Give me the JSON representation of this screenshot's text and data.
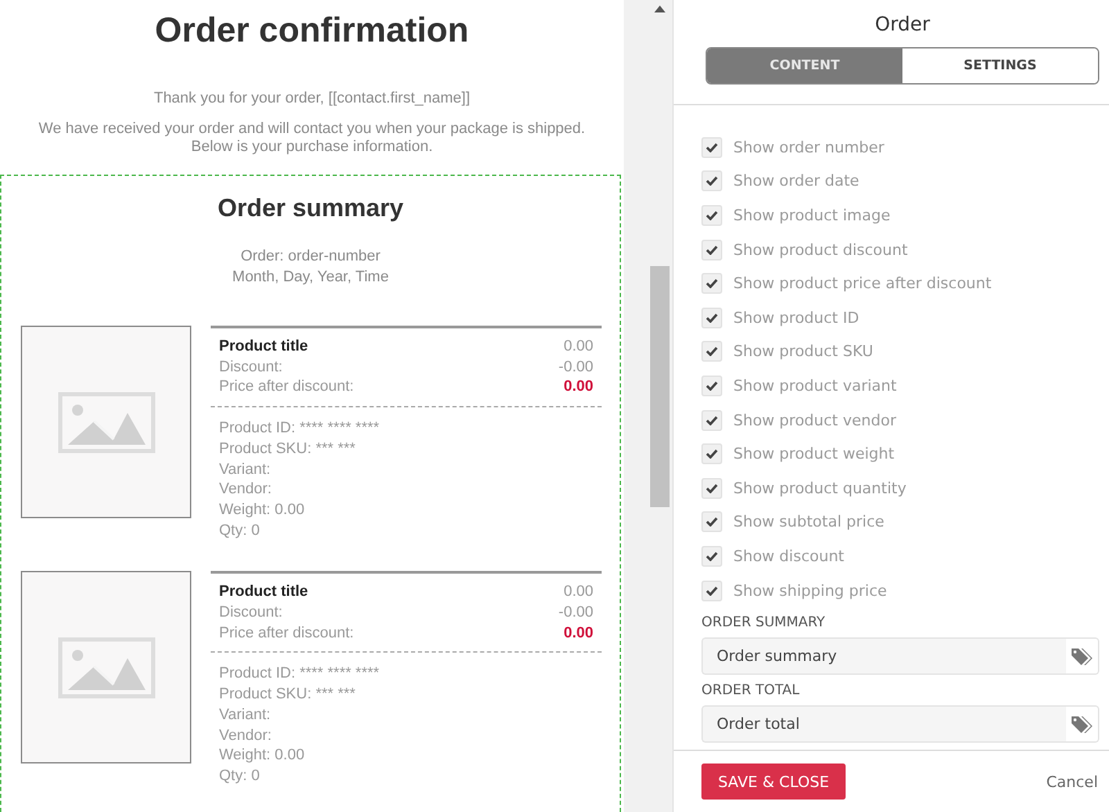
{
  "preview": {
    "title": "Order confirmation",
    "greeting": "Thank you for your order, [[contact.first_name]]",
    "intro": "We have received your order and will contact you when your package is shipped. Below is your purchase information.",
    "summary": {
      "title": "Order summary",
      "order_line": "Order: order-number",
      "date_line": "Month, Day, Year, Time",
      "products": [
        {
          "title": "Product title",
          "price": "0.00",
          "discount_label": "Discount:",
          "discount": "-0.00",
          "after_label": "Price after discount:",
          "after_price": "0.00",
          "details": [
            "Product ID: **** **** ****",
            "Product SKU: *** ***",
            "Variant:",
            "Vendor:",
            "Weight: 0.00",
            "Qty: 0"
          ]
        },
        {
          "title": "Product title",
          "price": "0.00",
          "discount_label": "Discount:",
          "discount": "-0.00",
          "after_label": "Price after discount:",
          "after_price": "0.00",
          "details": [
            "Product ID: **** **** ****",
            "Product SKU: *** ***",
            "Variant:",
            "Vendor:",
            "Weight: 0.00",
            "Qty: 0"
          ]
        }
      ]
    }
  },
  "panel": {
    "title": "Order",
    "tabs": [
      {
        "label": "CONTENT",
        "selected": true
      },
      {
        "label": "SETTINGS",
        "selected": false
      }
    ],
    "options": [
      {
        "label": "Show order number",
        "checked": true
      },
      {
        "label": "Show order date",
        "checked": true
      },
      {
        "label": "Show product image",
        "checked": true
      },
      {
        "label": "Show product discount",
        "checked": true
      },
      {
        "label": "Show product price after discount",
        "checked": true
      },
      {
        "label": "Show product ID",
        "checked": true
      },
      {
        "label": "Show product SKU",
        "checked": true
      },
      {
        "label": "Show product variant",
        "checked": true
      },
      {
        "label": "Show product vendor",
        "checked": true
      },
      {
        "label": "Show product weight",
        "checked": true
      },
      {
        "label": "Show product quantity",
        "checked": true
      },
      {
        "label": "Show subtotal price",
        "checked": true
      },
      {
        "label": "Show discount",
        "checked": true
      },
      {
        "label": "Show shipping price",
        "checked": true
      }
    ],
    "fields": [
      {
        "label": "ORDER SUMMARY",
        "value": "Order summary"
      },
      {
        "label": "ORDER TOTAL",
        "value": "Order total"
      }
    ],
    "save_button": "SAVE & CLOSE",
    "cancel_link": "Cancel"
  }
}
